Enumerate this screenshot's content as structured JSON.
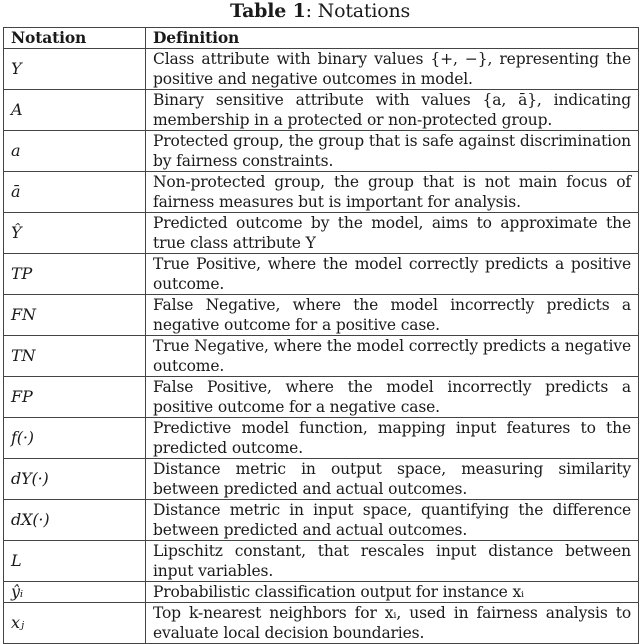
{
  "caption": {
    "label": "Table 1",
    "separator": ": ",
    "title": "Notations"
  },
  "table": {
    "headers": [
      "Notation",
      "Definition"
    ],
    "rows": [
      {
        "notation": "Y",
        "definition": "Class attribute with binary values {+, −}, representing the positive and negative outcomes in model."
      },
      {
        "notation": "A",
        "definition": "Binary sensitive attribute with values {a, ā}, indicating membership in a protected or non-protected group."
      },
      {
        "notation": "a",
        "definition": "Protected group, the group that is safe against discrimination by fairness constraints."
      },
      {
        "notation": "ā",
        "definition": "Non-protected group, the group that is not main focus of fairness measures but is important for analysis."
      },
      {
        "notation": "Ŷ",
        "definition": "Predicted outcome by the model, aims to approximate the true class attribute Y"
      },
      {
        "notation": "TP",
        "definition": "True Positive, where the model correctly predicts a positive outcome."
      },
      {
        "notation": "FN",
        "definition": "False Negative, where the model incorrectly predicts a negative outcome for a positive case."
      },
      {
        "notation": "TN",
        "definition": "True Negative, where the model correctly predicts a negative outcome."
      },
      {
        "notation": "FP",
        "definition": "False Positive, where the model incorrectly predicts a positive outcome for a negative case."
      },
      {
        "notation": "f(·)",
        "definition": "Predictive model function, mapping input features to the predicted outcome."
      },
      {
        "notation": "dY(·)",
        "definition": "Distance metric in output space, measuring similarity between predicted and actual outcomes."
      },
      {
        "notation": "dX(·)",
        "definition": "Distance metric in input space, quantifying the difference between predicted and actual outcomes."
      },
      {
        "notation": "L",
        "definition": "Lipschitz constant, that rescales input distance between input variables."
      },
      {
        "notation": "ŷᵢ",
        "definition": "Probabilistic classification output for instance xᵢ"
      },
      {
        "notation": "xⱼ",
        "definition": "Top k-nearest neighbors for xᵢ, used in fairness analysis to evaluate local decision boundaries."
      }
    ]
  }
}
